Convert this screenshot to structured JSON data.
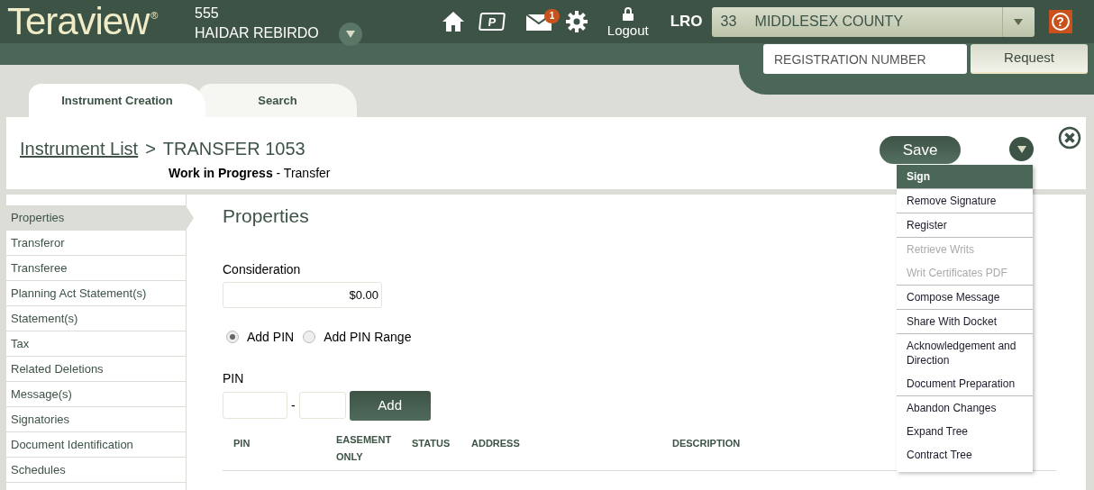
{
  "header": {
    "logo": "Teraview",
    "registered": "®",
    "user_number": "555",
    "user_name": "HAIDAR REBIRDO",
    "parking_label": "P",
    "mail_badge": "1",
    "logout": "Logout",
    "office_label": "LRO",
    "office": {
      "code": "33",
      "name": "MIDDLESEX COUNTY"
    },
    "help": "?",
    "registration": {
      "placeholder": "REGISTRATION NUMBER"
    },
    "request_button": "Request"
  },
  "tabs": [
    {
      "label": "Instrument Creation",
      "selected": true
    },
    {
      "label": "Search",
      "selected": false
    }
  ],
  "breadcrumb": {
    "link": "Instrument List",
    "separator": ">",
    "current": "TRANSFER 1053",
    "status": "**Work in Progress** - Transfer"
  },
  "save_button": "Save",
  "menu": {
    "groups": [
      [
        {
          "label": "Sign",
          "selected": true,
          "disabled": false
        }
      ],
      [
        {
          "label": "Remove Signature",
          "selected": false,
          "disabled": false
        }
      ],
      [
        {
          "label": "Register",
          "selected": false,
          "disabled": false
        }
      ],
      [
        {
          "label": "Retrieve Writs",
          "selected": false,
          "disabled": true
        },
        {
          "label": "Writ Certificates PDF",
          "selected": false,
          "disabled": true
        }
      ],
      [
        {
          "label": "Compose Message",
          "selected": false,
          "disabled": false
        }
      ],
      [
        {
          "label": "Share With Docket",
          "selected": false,
          "disabled": false
        }
      ],
      [
        {
          "label": "Acknowledgement and Direction",
          "selected": false,
          "disabled": false
        },
        {
          "label": "Document Preparation",
          "selected": false,
          "disabled": false
        }
      ],
      [
        {
          "label": "Abandon Changes",
          "selected": false,
          "disabled": false
        },
        {
          "label": "Expand Tree",
          "selected": false,
          "disabled": false
        },
        {
          "label": "Contract Tree",
          "selected": false,
          "disabled": false
        }
      ]
    ]
  },
  "sidebar": {
    "items": [
      {
        "label": "Properties",
        "selected": true
      },
      {
        "label": "Transferor",
        "selected": false
      },
      {
        "label": "Transferee",
        "selected": false
      },
      {
        "label": "Planning Act Statement(s)",
        "selected": false
      },
      {
        "label": "Statement(s)",
        "selected": false
      },
      {
        "label": "Tax",
        "selected": false
      },
      {
        "label": "Related Deletions",
        "selected": false
      },
      {
        "label": "Message(s)",
        "selected": false
      },
      {
        "label": "Signatories",
        "selected": false
      },
      {
        "label": "Document Identification",
        "selected": false
      },
      {
        "label": "Schedules",
        "selected": false
      }
    ]
  },
  "section": {
    "title": "Properties",
    "consideration_label": "Consideration",
    "consideration_value": "$0.00",
    "radios": [
      {
        "label": "Add PIN",
        "selected": true
      },
      {
        "label": "Add PIN Range",
        "selected": false
      }
    ],
    "pin_label": "PIN",
    "pin_separator": "-",
    "add_button": "Add",
    "table": {
      "columns": [
        "PIN",
        "EASEMENT ONLY",
        "STATUS",
        "ADDRESS",
        "DESCRIPTION"
      ]
    }
  }
}
